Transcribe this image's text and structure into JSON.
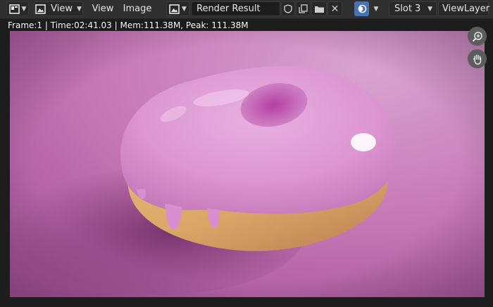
{
  "header": {
    "editor_type_icon": "image-editor-icon",
    "view_mode_icon": "image-icon",
    "view_mode_label": "View",
    "menus": [
      "View",
      "Image"
    ],
    "image_browse_icon": "image-browse-icon",
    "image_name": "Render Result",
    "fake_user_icon": "shield-icon",
    "duplicate_icon": "duplicate-icon",
    "open_icon": "folder-icon",
    "unlink_icon": "close-icon",
    "overlay_icon": "overlay-icon",
    "slot_label": "Slot 3",
    "view_layer_label": "ViewLayer"
  },
  "info": {
    "text": "Frame:1 | Time:02:41.03 | Mem:111.38M, Peak: 111.38M"
  },
  "nav": {
    "zoom_icon": "zoom-icon",
    "pan_icon": "hand-icon"
  },
  "colors": {
    "header_bg": "#303030",
    "active_blue": "#4772b3",
    "background_pink": "#c77ab8"
  }
}
